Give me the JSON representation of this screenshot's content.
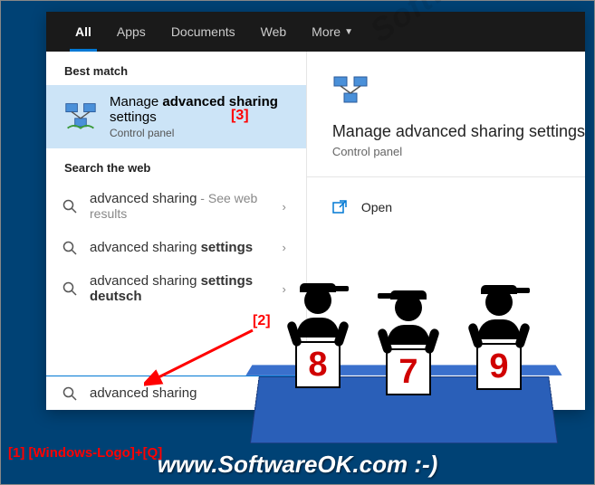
{
  "tabs": {
    "all": "All",
    "apps": "Apps",
    "documents": "Documents",
    "web": "Web",
    "more": "More"
  },
  "sections": {
    "best_match": "Best match",
    "search_web": "Search the web"
  },
  "best_match": {
    "title_pre": "Manage ",
    "title_bold": "advanced sharing",
    "title_post": " settings",
    "subtitle": "Control panel"
  },
  "web_results": [
    {
      "pre": "advanced sharing",
      "bold": "",
      "hint": " - See web results"
    },
    {
      "pre": "advanced sharing ",
      "bold": "settings",
      "hint": ""
    },
    {
      "pre": "advanced sharing ",
      "bold": "settings deutsch",
      "hint": ""
    }
  ],
  "search_query": "advanced sharing",
  "right": {
    "title": "Manage advanced sharing settings",
    "subtitle": "Control panel",
    "open": "Open"
  },
  "annotations": {
    "a1": "[1] [Windows-Logo]+[Q]",
    "a2": "[2]",
    "a3": "[3]"
  },
  "scores": [
    "8",
    "7",
    "9"
  ],
  "watermark": {
    "diag": "SoftwareOK.com",
    "bottom": "www.SoftwareOK.com :-)"
  }
}
